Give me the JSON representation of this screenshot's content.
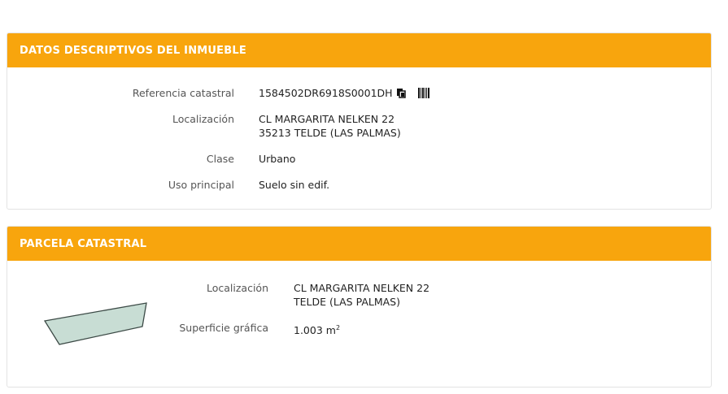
{
  "inmueble": {
    "title": "DATOS DESCRIPTIVOS DEL INMUEBLE",
    "ref_label": "Referencia catastral",
    "ref_value": "1584502DR6918S0001DH",
    "copy_icon": "copy-icon",
    "barcode_icon": "barcode-icon",
    "loc_label": "Localización",
    "loc_line1": "CL MARGARITA NELKEN 22",
    "loc_line2": "35213 TELDE (LAS PALMAS)",
    "clase_label": "Clase",
    "clase_value": "Urbano",
    "uso_label": "Uso principal",
    "uso_value": "Suelo sin edif."
  },
  "parcela": {
    "title": "PARCELA CATASTRAL",
    "loc_label": "Localización",
    "loc_line1": "CL MARGARITA NELKEN 22",
    "loc_line2": "TELDE (LAS PALMAS)",
    "sup_label": "Superficie gráfica",
    "sup_value": "1.003 m",
    "sup_unit_exp": "2",
    "shape_fill": "#c8ddd4",
    "shape_stroke": "#3c4a46"
  },
  "colors": {
    "header": "#f8a50d"
  }
}
